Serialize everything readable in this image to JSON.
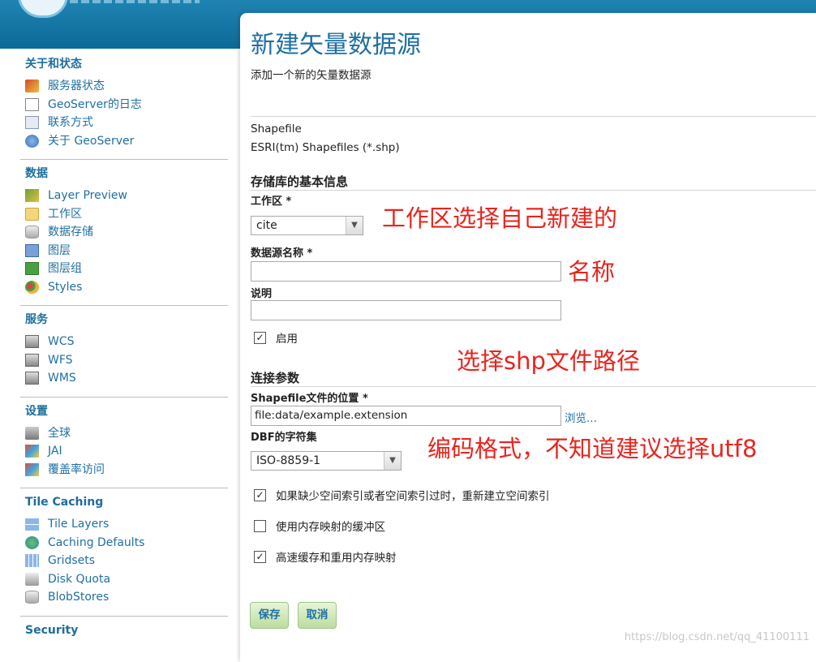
{
  "sidebar": {
    "sections": [
      {
        "title": "关于和状态",
        "items": [
          "服务器状态",
          "GeoServer的日志",
          "联系方式",
          "关于 GeoServer"
        ]
      },
      {
        "title": "数据",
        "items": [
          "Layer Preview",
          "工作区",
          "数据存储",
          "图层",
          "图层组",
          "Styles"
        ]
      },
      {
        "title": "服务",
        "items": [
          "WCS",
          "WFS",
          "WMS"
        ]
      },
      {
        "title": "设置",
        "items": [
          "全球",
          "JAI",
          "覆盖率访问"
        ]
      },
      {
        "title": "Tile Caching",
        "items": [
          "Tile Layers",
          "Caching Defaults",
          "Gridsets",
          "Disk Quota",
          "BlobStores"
        ]
      },
      {
        "title": "Security",
        "items": []
      }
    ]
  },
  "main": {
    "title": "新建矢量数据源",
    "description": "添加一个新的矢量数据源",
    "source_type": "Shapefile",
    "source_desc": "ESRI(tm) Shapefiles (*.shp)",
    "basic_info_title": "存储库的基本信息",
    "workspace_label": "工作区 *",
    "workspace_value": "cite",
    "name_label": "数据源名称 *",
    "name_value": "",
    "desc_label": "说明",
    "desc_value": "",
    "enabled_label": "启用",
    "enabled_checked": "✓",
    "conn_title": "连接参数",
    "shapefile_label": "Shapefile文件的位置 *",
    "shapefile_value": "file:data/example.extension",
    "browse_label": "浏览...",
    "charset_label": "DBF的字符集",
    "charset_value": "ISO-8859-1",
    "opt1_label": "如果缺少空间索引或者空间索引过时，重新建立空间索引",
    "opt1_checked": "✓",
    "opt2_label": "使用内存映射的缓冲区",
    "opt2_checked": "",
    "opt3_label": "高速缓存和重用内存映射",
    "opt3_checked": "✓",
    "save_label": "保存",
    "cancel_label": "取消"
  },
  "annotations": {
    "workspace_note": "工作区选择自己新建的",
    "name_note": "名称",
    "path_note": "选择shp文件路径",
    "charset_note": "编码格式，不知道建议选择utf8"
  },
  "watermark": "https://blog.csdn.net/qq_41100111"
}
